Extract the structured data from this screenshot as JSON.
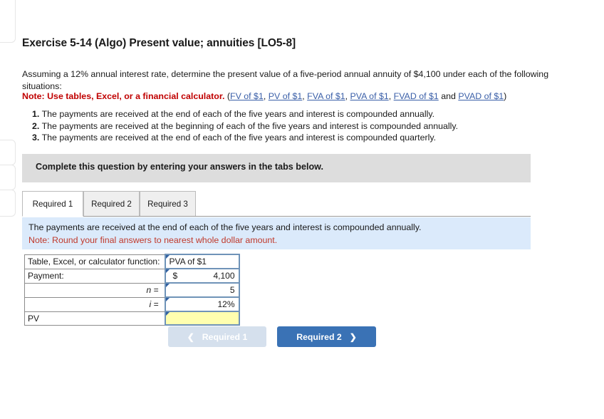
{
  "page": {
    "title": "Exercise 5-14 (Algo) Present value; annuities [LO5-8]",
    "intro": "Assuming a 12% annual interest rate, determine the present value of a five-period annual annuity of $4,100 under each of the following situations:",
    "note_bold": "Note: Use tables, Excel, or a financial calculator.",
    "paren_open": "(",
    "links": [
      "FV of $1",
      "PV of $1",
      "FVA of $1",
      "PVA of $1",
      "FVAD of $1",
      "PVAD of $1"
    ],
    "link_sep": ", ",
    "link_and": " and ",
    "paren_close": ")"
  },
  "situations": [
    {
      "num": "1.",
      "text": "The payments are received at the end of each of the five years and interest is compounded annually."
    },
    {
      "num": "2.",
      "text": "The payments are received at the beginning of each of the five years and interest is compounded annually."
    },
    {
      "num": "3.",
      "text": "The payments are received at the end of each of the five years and interest is compounded quarterly."
    }
  ],
  "instruction_bar": {
    "text": "Complete this question by entering your answers in the tabs below."
  },
  "tabs": [
    {
      "label": "Required 1",
      "active": true
    },
    {
      "label": "Required 2",
      "active": false
    },
    {
      "label": "Required 3",
      "active": false
    }
  ],
  "info_panel": {
    "line1": "The payments are received at the end of each of the five years and interest is compounded annually.",
    "line2": "Note: Round your final answers to nearest whole dollar amount."
  },
  "calc_table": {
    "rows": [
      {
        "label": "Table, Excel, or calculator function:",
        "value": "PVA of $1"
      },
      {
        "label": "Payment:",
        "prefix": "$",
        "value": "4,100"
      },
      {
        "label": "n =",
        "value": "5"
      },
      {
        "label": "i =",
        "value": "12%"
      },
      {
        "label": "PV",
        "value": ""
      }
    ]
  },
  "nav": {
    "prev_label": "Required 1",
    "next_label": "Required 2",
    "prev_icon": "❮",
    "next_icon": "❯"
  },
  "colors": {
    "accent_blue": "#3a72b5",
    "disabled_blue": "#d5e0ed",
    "info_panel_bg": "#dbeafb",
    "gray_bar_bg": "#dddddd",
    "answer_cell_yellow": "#ffffaf",
    "note_red": "#c00000",
    "link_blue": "#3a5fa8"
  }
}
